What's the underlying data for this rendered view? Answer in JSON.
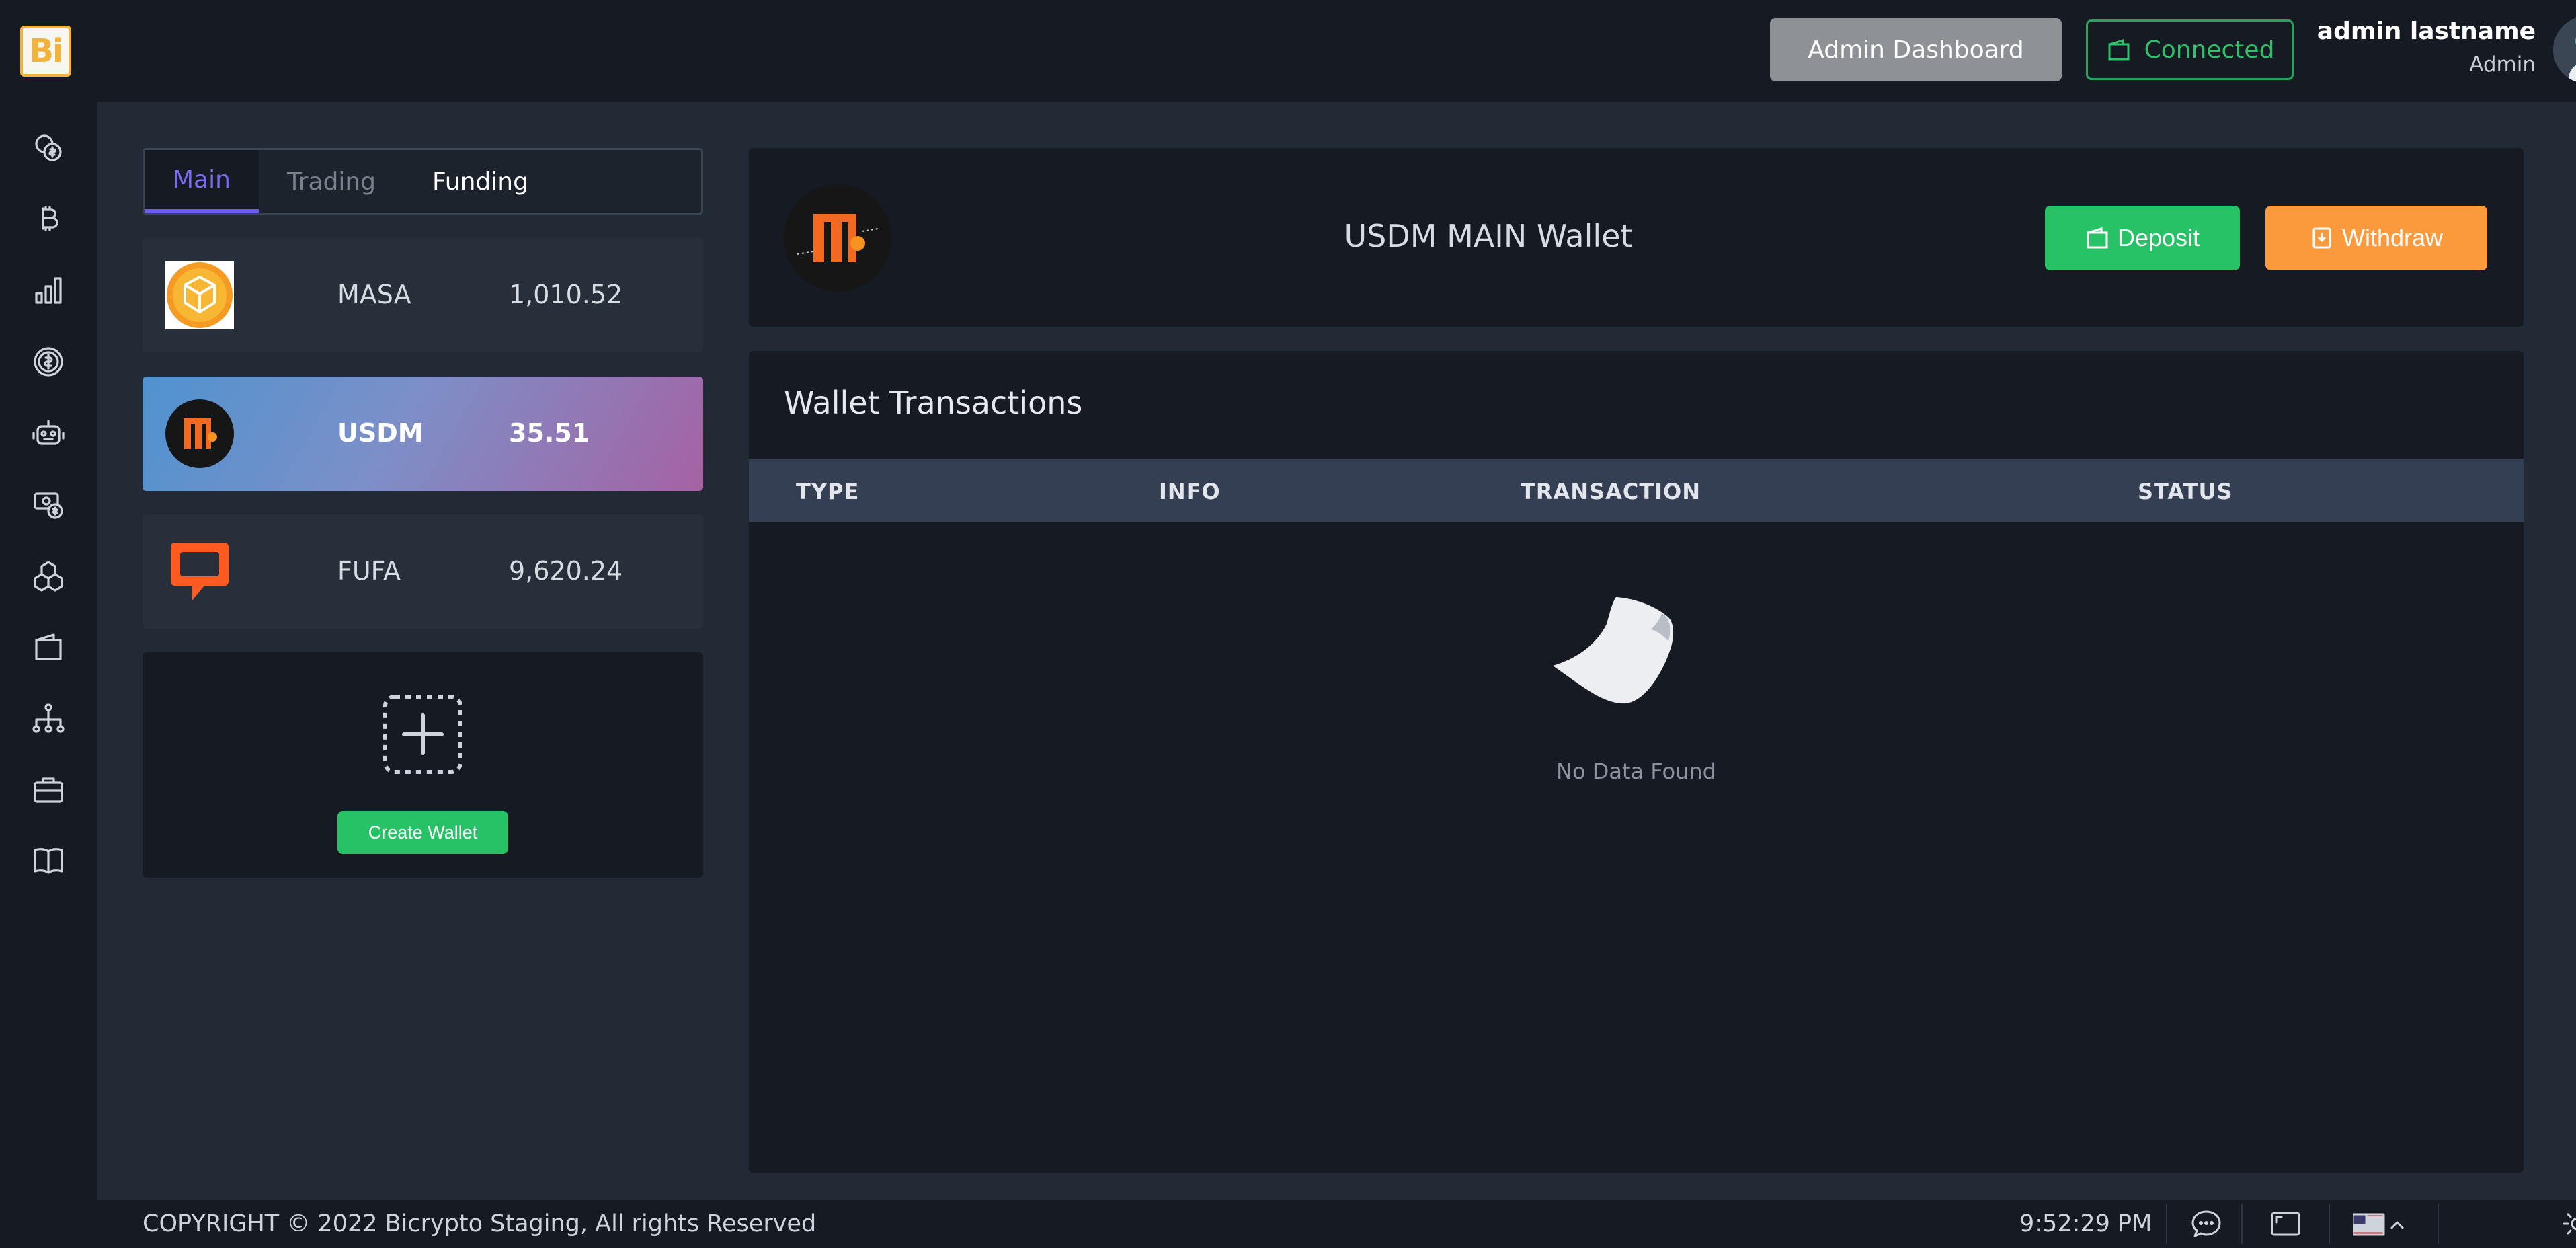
{
  "app": {
    "logo_text": "Bi"
  },
  "sidebar": {
    "icons": [
      "coins-exchange-icon",
      "bitcoin-icon",
      "bar-chart-icon",
      "dollar-coin-icon",
      "robot-icon",
      "money-transfer-icon",
      "cubes-icon",
      "wallet-icon",
      "hierarchy-icon",
      "briefcase-icon",
      "book-icon"
    ]
  },
  "header": {
    "admin_button": "Admin Dashboard",
    "connected_button": "Connected",
    "user_name": "admin lastname",
    "user_role": "Admin"
  },
  "tabs": [
    {
      "label": "Main",
      "state": "active"
    },
    {
      "label": "Trading",
      "state": "inactive"
    },
    {
      "label": "Funding",
      "state": "normal"
    }
  ],
  "wallets": [
    {
      "symbol": "MASA",
      "balance": "1,010.52",
      "selected": false
    },
    {
      "symbol": "USDM",
      "balance": "35.51",
      "selected": true
    },
    {
      "symbol": "FUFA",
      "balance": "9,620.24",
      "selected": false
    }
  ],
  "create_wallet": {
    "button_label": "Create Wallet"
  },
  "wallet_card": {
    "title": "USDM MAIN Wallet",
    "deposit_label": "Deposit",
    "withdraw_label": "Withdraw"
  },
  "transactions": {
    "title": "Wallet Transactions",
    "columns": [
      "TYPE",
      "INFO",
      "TRANSACTION",
      "STATUS"
    ],
    "empty_text": "No Data Found"
  },
  "footer": {
    "copyright": "COPYRIGHT © 2022  Bicrypto Staging, All rights Reserved",
    "time": "9:52:29 PM"
  },
  "colors": {
    "accent": "#6a5af0",
    "success": "#26c265",
    "warning": "#fb9a3c",
    "admin_button": "#8e9196"
  }
}
